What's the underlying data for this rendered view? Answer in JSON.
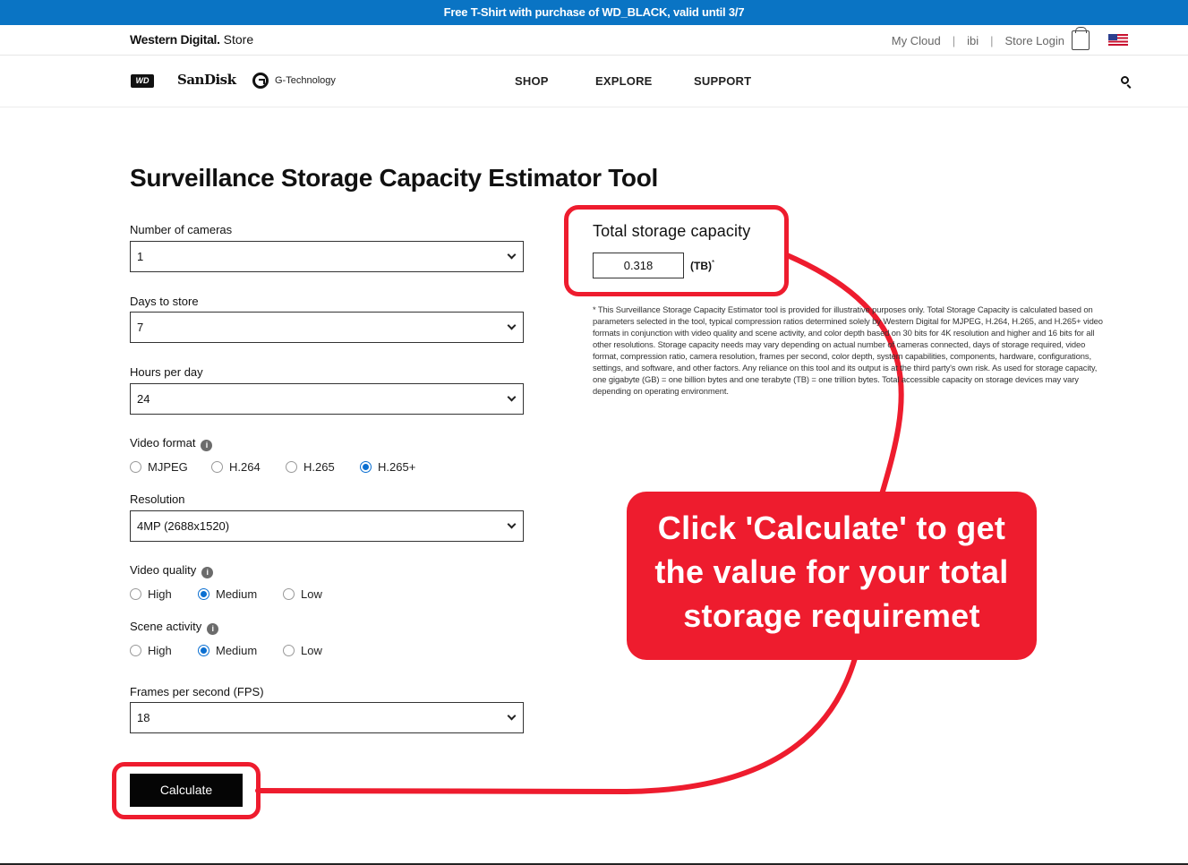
{
  "promo": {
    "text": "Free T-Shirt with purchase of WD_BLACK, valid until 3/7"
  },
  "topbar": {
    "brand_bold": "Western Digital.",
    "brand_light": " Store",
    "links": [
      "My Cloud",
      "ibi",
      "Store Login"
    ],
    "separator": "|"
  },
  "nav": {
    "wd_logo": "WD",
    "sandisk": "SanDisk",
    "gtech": "G-Technology",
    "items": [
      "SHOP",
      "EXPLORE",
      "SUPPORT"
    ]
  },
  "page": {
    "title": "Surveillance Storage Capacity Estimator Tool"
  },
  "form": {
    "cameras": {
      "label": "Number of cameras",
      "value": "1"
    },
    "days": {
      "label": "Days to store",
      "value": "7"
    },
    "hours": {
      "label": "Hours per day",
      "value": "24"
    },
    "video_format": {
      "label": "Video format",
      "options": [
        "MJPEG",
        "H.264",
        "H.265",
        "H.265+"
      ],
      "selected": "H.265+"
    },
    "resolution": {
      "label": "Resolution",
      "value": "4MP (2688x1520)"
    },
    "video_quality": {
      "label": "Video quality",
      "options": [
        "High",
        "Medium",
        "Low"
      ],
      "selected": "Medium"
    },
    "scene_activity": {
      "label": "Scene activity",
      "options": [
        "High",
        "Medium",
        "Low"
      ],
      "selected": "Medium"
    },
    "fps": {
      "label": "Frames per second (FPS)",
      "value": "18"
    },
    "calculate_label": "Calculate",
    "info_glyph": "i"
  },
  "result": {
    "title": "Total storage capacity",
    "value": "0.318",
    "unit": "(TB)",
    "unit_mark": "*",
    "disclaimer": "* This Surveillance Storage Capacity Estimator tool is provided for illustrative purposes only. Total Storage Capacity is calculated based on parameters selected in the tool, typical compression ratios determined solely by Western Digital for MJPEG, H.264, H.265, and H.265+ video formats in conjunction with video quality and scene activity, and color depth based on 30 bits for 4K resolution and higher and 16 bits for all other resolutions. Storage capacity needs may vary depending on actual number of cameras connected, days of storage required, video format, compression ratio, camera resolution, frames per second, color depth, system capabilities, components, hardware, configurations, settings, and software, and other factors. Any reliance on this tool and its output is at the third party's own risk. As used for storage capacity, one gigabyte (GB) = one billion bytes and one terabyte (TB) = one trillion bytes. Total accessible capacity on storage devices may vary depending on operating environment."
  },
  "annotation": {
    "callout_lines": [
      "Click 'Calculate' to get",
      "the value for your total",
      "storage requiremet"
    ],
    "accent_color": "#ee1c2e"
  }
}
